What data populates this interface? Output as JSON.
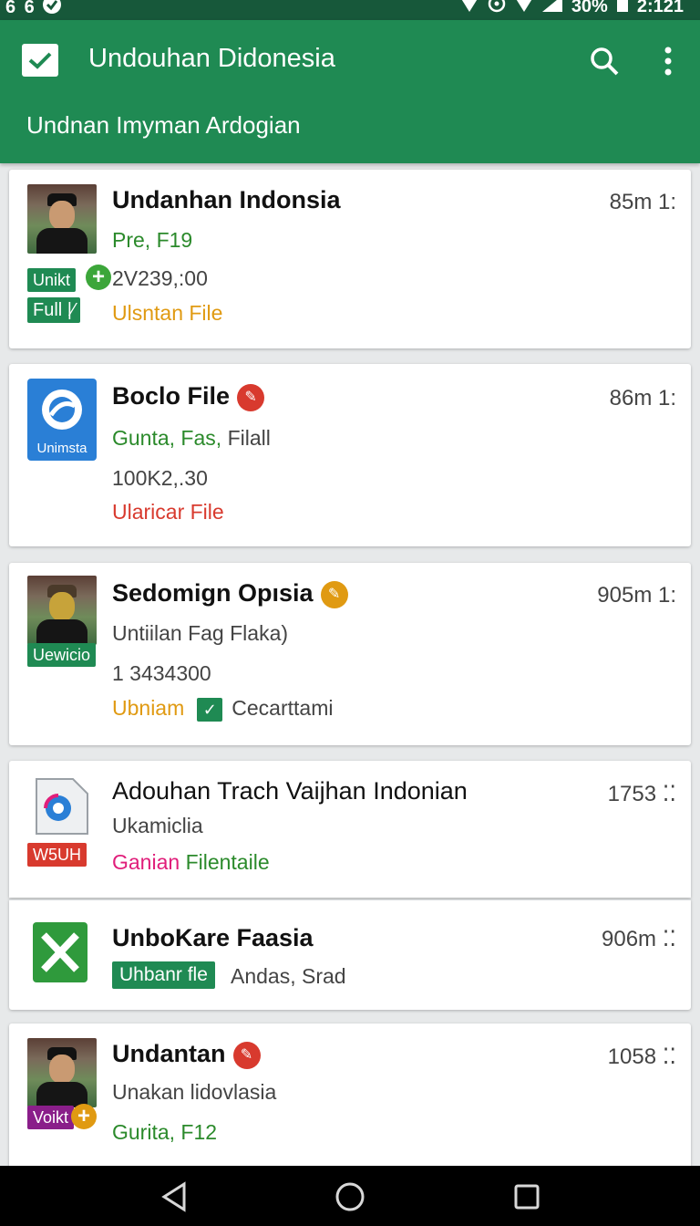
{
  "status_bar": {
    "left_icons": [
      "notification-icon",
      "notification-icon",
      "app-icon"
    ],
    "left_text": "6 6",
    "battery": "30%",
    "time": "2:121"
  },
  "app_bar": {
    "title": "Undouhan Didonesia",
    "subtitle": "Undnan Imyman Ardogian"
  },
  "items": [
    {
      "title": "Undanhan Indonsia",
      "time": "85m 1:",
      "line1": "Pre, F19",
      "line2": "2V239,:00",
      "line3": "Ulsntan File",
      "thumb_badge": "Unikt",
      "label_badge": "Full"
    },
    {
      "title": "Boclo File",
      "time": "86m 1:",
      "line1_green": "Gunta, Fas,",
      "line1_gray": "Filall",
      "line2": "100K2,.30",
      "line3": "Ularicar File",
      "icon_label": "Unimsta"
    },
    {
      "title": "Sedomign Opısia",
      "time": "905m 1:",
      "line1": "Untiilan Fag Flaka)",
      "line2": "1 3434300",
      "line3a": "Ubniam",
      "line3b": "Cecarttami",
      "thumb_badge": "Uewicio"
    },
    {
      "title": "Adouhan Trach Vaijhan Indonian",
      "time": "1753",
      "line1": "Ukamiclia",
      "line2a": "Ganian",
      "line2b": "Filentaile",
      "icon_badge": "W5UH"
    },
    {
      "title": "UnboKare Faasia",
      "time": "906m",
      "label_badge": "Uhbanr fle",
      "line1": "Andas, Srad"
    },
    {
      "title": "Undantan",
      "time": "1058",
      "line1": "Unakan lidovlasia",
      "line2": "Gurita, F12",
      "thumb_badge": "Voikt"
    }
  ],
  "colors": {
    "status_bar": "#17583a",
    "app_bar": "#1f8a53",
    "accent_green": "#2b8a2b",
    "orange": "#e09a12",
    "red": "#d83a2e",
    "pink": "#e01e7a"
  }
}
